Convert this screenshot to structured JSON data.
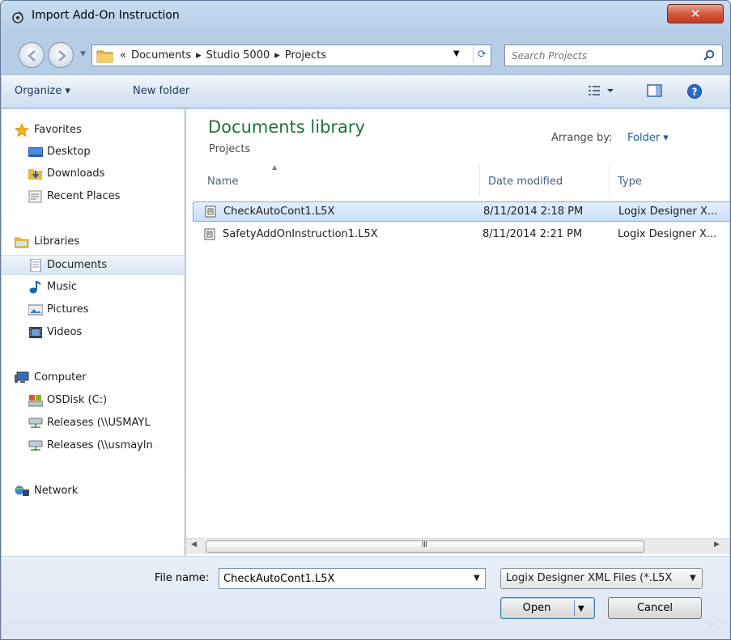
{
  "window": {
    "title": "Import Add-On Instruction",
    "close_glyph": "✕"
  },
  "address": {
    "breadcrumbs": [
      "«",
      "Documents",
      "▸",
      "Studio 5000",
      "▸",
      "Projects"
    ],
    "search_placeholder": "Search Projects"
  },
  "toolbar": {
    "organize_label": "Organize ▾",
    "new_folder_label": "New folder"
  },
  "sidebar": {
    "favorites": {
      "label": "Favorites",
      "items": [
        "Desktop",
        "Downloads",
        "Recent Places"
      ]
    },
    "libraries": {
      "label": "Libraries",
      "items": [
        "Documents",
        "Music",
        "Pictures",
        "Videos"
      ]
    },
    "computer": {
      "label": "Computer",
      "items": [
        "OSDisk (C:)",
        "Releases (\\\\USMAYL",
        "Releases (\\\\usmayln"
      ]
    },
    "network": {
      "label": "Network"
    }
  },
  "main": {
    "library_title": "Documents library",
    "library_subtitle": "Projects",
    "arrange_label": "Arrange by:",
    "arrange_value": "Folder ▾",
    "columns": [
      "Name",
      "Date modified",
      "Type"
    ],
    "files": [
      {
        "name": "CheckAutoCont1.L5X",
        "date": "8/11/2014 2:18 PM",
        "type": "Logix Designer X..."
      },
      {
        "name": "SafetyAddOnInstruction1.L5X",
        "date": "8/11/2014 2:21 PM",
        "type": "Logix Designer X..."
      }
    ],
    "scroll_grip": "III"
  },
  "bottom": {
    "file_name_label": "File name:",
    "file_name_value": "CheckAutoCont1.L5X",
    "filter_value": "Logix Designer XML Files (*.L5X",
    "open_label": "Open",
    "cancel_label": "Cancel"
  },
  "colors": {
    "library_title": "#1e7145",
    "accent_link": "#1f5da6",
    "selection": "#c9dff7"
  }
}
